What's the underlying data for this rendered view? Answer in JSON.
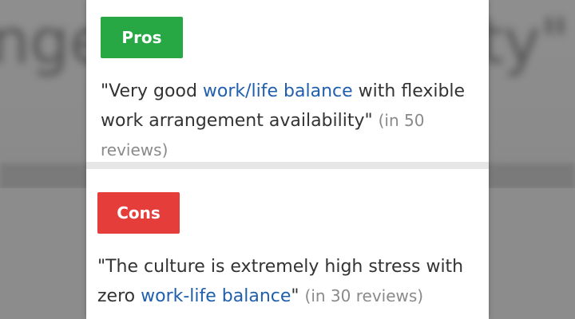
{
  "pros": {
    "badge_label": "Pros",
    "quote_before": "\"Very good ",
    "quote_link": "work/life balance",
    "quote_after": " with flexible work arrangement availability\"",
    "review_count": "(in 50 reviews)"
  },
  "cons": {
    "badge_label": "Cons",
    "quote_before": "\"The culture is extremely high stress with zero ",
    "quote_link": "work-life balance",
    "quote_after": "\"",
    "review_count": "(in 30 reviews)"
  },
  "colors": {
    "pros_badge": "#28a745",
    "cons_badge": "#e53e3a",
    "link": "#1f5fae",
    "count": "#8a8a8a"
  }
}
